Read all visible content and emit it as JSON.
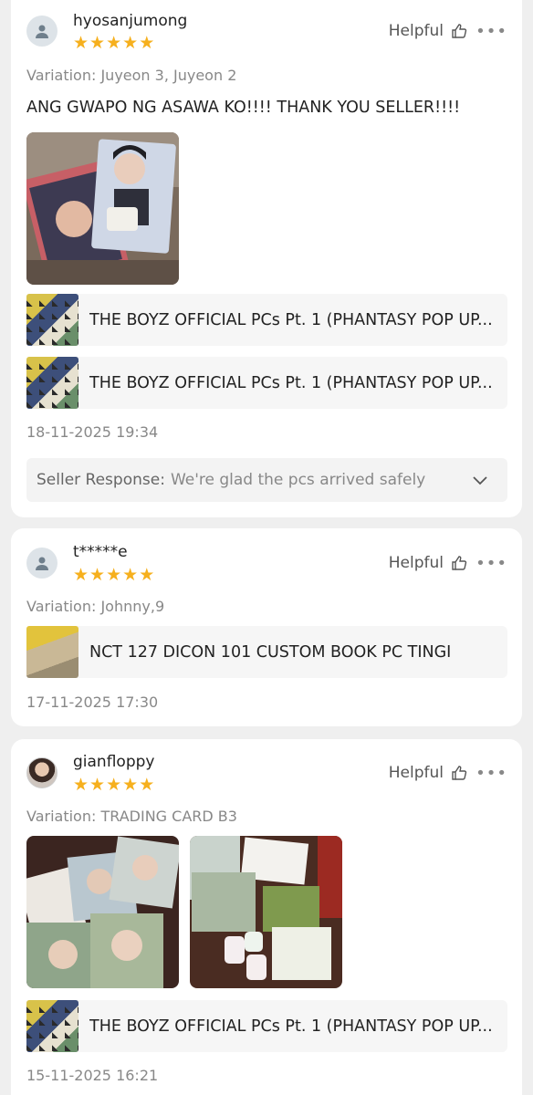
{
  "colors": {
    "star": "#f6b01e",
    "background": "#efefef",
    "card": "#ffffff"
  },
  "reviews": [
    {
      "username": "hyosanjumong",
      "rating": 5,
      "helpful_label": "Helpful",
      "more_label": "•••",
      "variation": "Variation: Juyeon 3, Juyeon 2",
      "text": "ANG GWAPO NG ASAWA KO!!!! THANK YOU SELLER!!!!",
      "products": [
        "THE BOYZ OFFICIAL PCs Pt. 1 (PHANTASY POP UP...",
        "THE BOYZ OFFICIAL PCs Pt. 1 (PHANTASY POP UP..."
      ],
      "date": "18-11-2025 19:34",
      "seller_response_label": "Seller Response:",
      "seller_response_text": "We're glad the pcs arrived safely"
    },
    {
      "username": "t*****e",
      "rating": 5,
      "helpful_label": "Helpful",
      "more_label": "•••",
      "variation": "Variation: Johnny,9",
      "products": [
        "NCT 127 DICON 101 CUSTOM BOOK PC TINGI"
      ],
      "date": "17-11-2025 17:30"
    },
    {
      "username": "gianfloppy",
      "rating": 5,
      "helpful_label": "Helpful",
      "more_label": "•••",
      "variation": "Variation: TRADING CARD B3",
      "products": [
        "THE BOYZ OFFICIAL PCs Pt. 1 (PHANTASY POP UP..."
      ],
      "date": "15-11-2025 16:21"
    }
  ]
}
